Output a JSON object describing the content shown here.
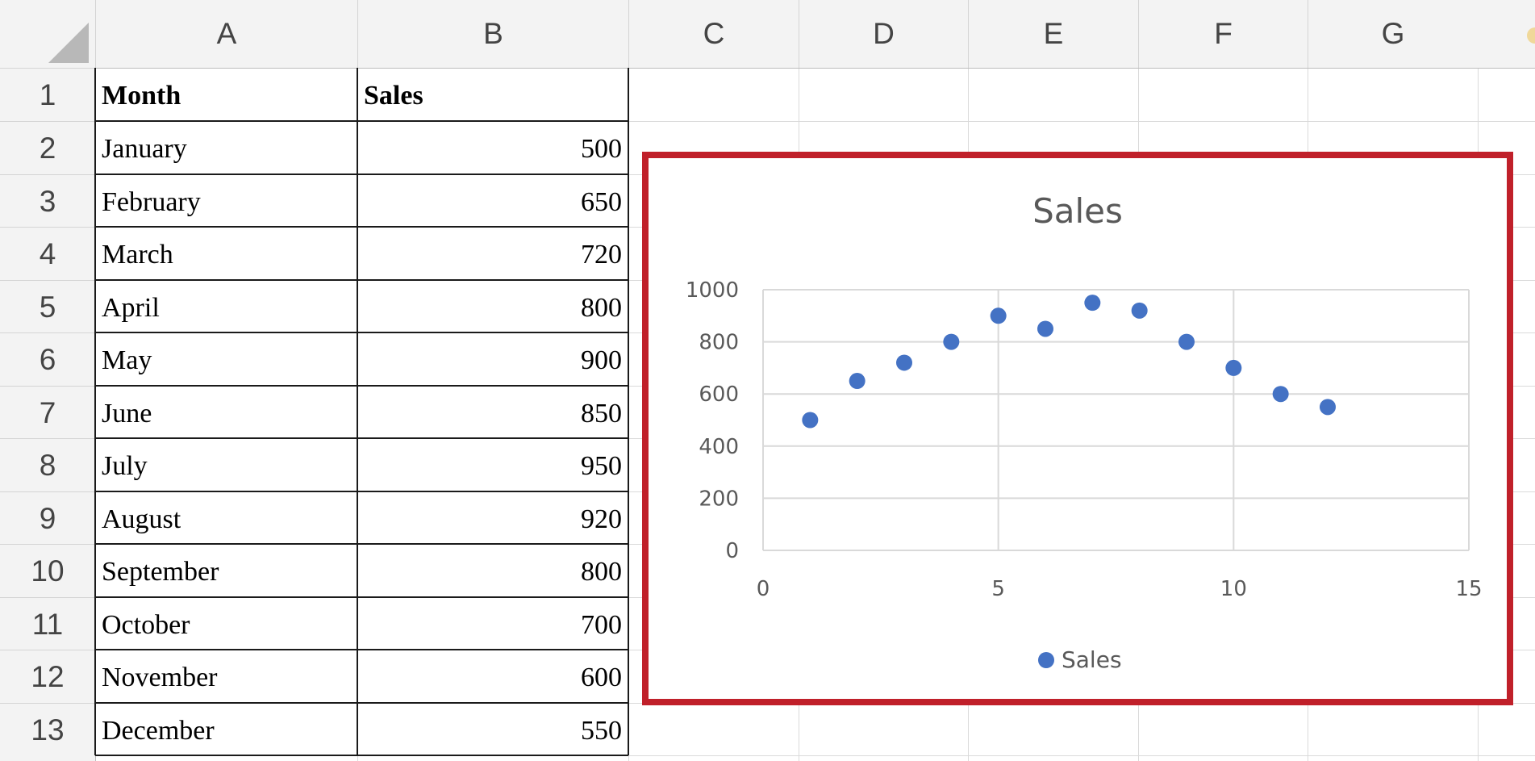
{
  "sheet": {
    "columns": [
      "A",
      "B",
      "C",
      "D",
      "E",
      "F",
      "G"
    ],
    "rows": [
      "1",
      "2",
      "3",
      "4",
      "5",
      "6",
      "7",
      "8",
      "9",
      "10",
      "11",
      "12",
      "13"
    ]
  },
  "table": {
    "headers": {
      "month": "Month",
      "sales": "Sales"
    },
    "rows": [
      {
        "month": "January",
        "sales": "500"
      },
      {
        "month": "February",
        "sales": "650"
      },
      {
        "month": "March",
        "sales": "720"
      },
      {
        "month": "April",
        "sales": "800"
      },
      {
        "month": "May",
        "sales": "900"
      },
      {
        "month": "June",
        "sales": "850"
      },
      {
        "month": "July",
        "sales": "950"
      },
      {
        "month": "August",
        "sales": "920"
      },
      {
        "month": "September",
        "sales": "800"
      },
      {
        "month": "October",
        "sales": "700"
      },
      {
        "month": "November",
        "sales": "600"
      },
      {
        "month": "December",
        "sales": "550"
      }
    ]
  },
  "chart_data": {
    "type": "scatter",
    "title": "Sales",
    "xlabel": "",
    "ylabel": "",
    "xlim": [
      0,
      15
    ],
    "ylim": [
      0,
      1000
    ],
    "x_ticks": [
      0,
      5,
      10,
      15
    ],
    "y_ticks": [
      0,
      200,
      400,
      600,
      800,
      1000
    ],
    "grid": true,
    "legend_position": "bottom",
    "series": [
      {
        "name": "Sales",
        "color": "#4472c4",
        "x": [
          1,
          2,
          3,
          4,
          5,
          6,
          7,
          8,
          9,
          10,
          11,
          12
        ],
        "y": [
          500,
          650,
          720,
          800,
          900,
          850,
          950,
          920,
          800,
          700,
          600,
          550
        ]
      }
    ]
  },
  "colors": {
    "selection_border": "#c0202a",
    "marker": "#4472c4",
    "gridline": "#d9d9d9"
  }
}
